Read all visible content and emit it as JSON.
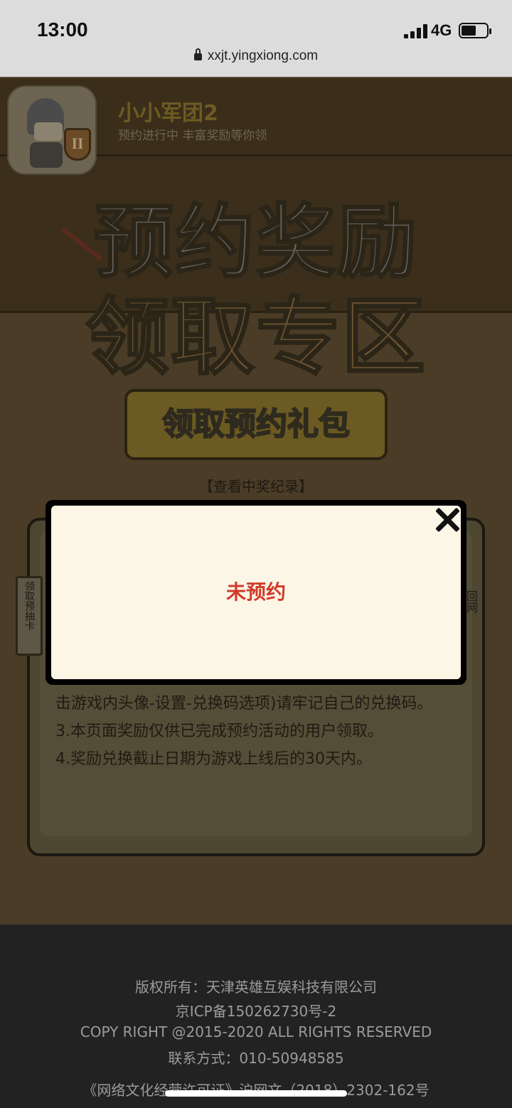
{
  "status_bar": {
    "time": "13:00",
    "network": "4G"
  },
  "browser": {
    "url": "xxjt.yingxiong.com"
  },
  "header": {
    "app_name": "小小军团2",
    "tagline": "预约进行中 丰富奖励等你领",
    "icon_badge": "II"
  },
  "hero": {
    "title_line1": "预约奖励",
    "title_line2": "领取专区"
  },
  "main": {
    "claim_button": "领取预约礼包",
    "records_link": "【查看中奖纪录】",
    "rules": [
      "击游戏内头像-设置-兑换码选项)请牢记自己的兑换码。",
      "3.本页面奖励仅供已完成预约活动的用户领取。",
      "4.奖励兑换截止日期为游戏上线后的30天内。"
    ],
    "side_left": "领取预抽卡",
    "side_right": "回网"
  },
  "modal": {
    "message": "未预约"
  },
  "footer": {
    "copyright": "版权所有：天津英雄互娱科技有限公司",
    "icp": "京ICP备150262730号-2",
    "copy_right": "COPY RIGHT @2015-2020 ALL RIGHTS RESERVED",
    "contact": "联系方式：010-50948585",
    "license": "《网络文化经营许可证》沪网文（2018）2302-162号"
  },
  "colors": {
    "modal_message": "#d13b2a",
    "modal_bg": "#fcf6e6",
    "footer_bg": "#222222"
  }
}
